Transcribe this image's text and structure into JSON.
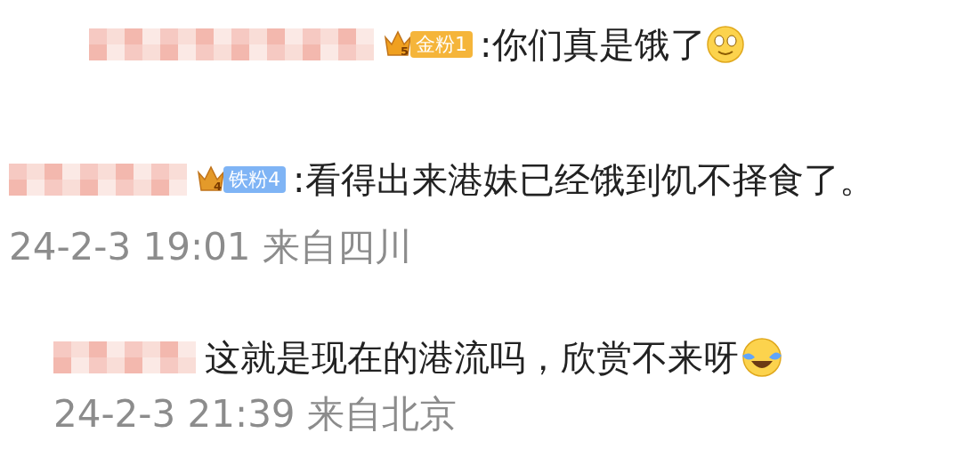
{
  "rows": [
    {
      "kind": "comment",
      "badge": {
        "kind": "gold",
        "level_digit": "5",
        "label": "金粉1"
      },
      "text": ":你们真是饿了",
      "emoji": {
        "kind": "smile"
      }
    },
    {
      "kind": "comment",
      "badge": {
        "kind": "iron",
        "level_digit": "4",
        "label": "铁粉4"
      },
      "text": ":看得出来港妹已经饿到饥不择食了。"
    },
    {
      "kind": "timestamp",
      "text": "24-2-3 19:01 来自四川"
    },
    {
      "kind": "comment",
      "text": "这就是现在的港流吗，欣赏不来呀",
      "emoji": {
        "kind": "cry"
      }
    },
    {
      "kind": "timestamp",
      "text": "24-2-3 21:39 来自北京"
    }
  ]
}
